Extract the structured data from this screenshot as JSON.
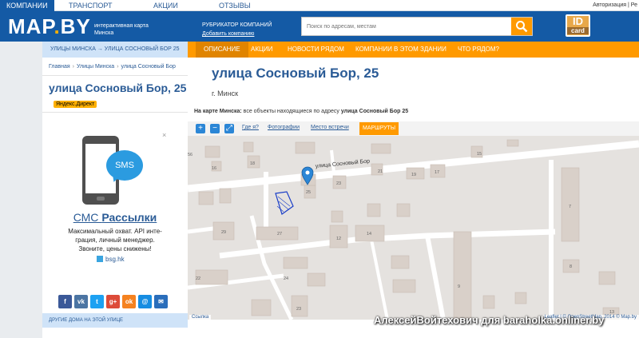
{
  "topnav": {
    "tabs": [
      {
        "label": "КОМПАНИИ"
      },
      {
        "label": "ТРАНСПОРТ"
      },
      {
        "label": "АКЦИИ"
      },
      {
        "label": "ОТЗЫВЫ"
      }
    ],
    "auth": "Авторизация | Ре"
  },
  "header": {
    "logo_main": "MAP",
    "logo_dot": ".",
    "logo_suffix": "BY",
    "tagline_1": "интерактивная карта",
    "tagline_2": "Минска",
    "rubricator": "РУБРИКАТОР КОМПАНИЙ",
    "add_company": "Добавить компанию",
    "search_placeholder": "Поиск по адресам, местам",
    "id_top": "ID",
    "id_bottom": "card"
  },
  "crumbbar": "УЛИЦЫ МИНСКА → УЛИЦА СОСНОВЫЙ БОР 25",
  "subnav": [
    {
      "label": "ОПИСАНИЕ"
    },
    {
      "label": "АКЦИИ"
    },
    {
      "label": "НОВОСТИ РЯДОМ"
    },
    {
      "label": "КОМПАНИИ В ЭТОМ ЗДАНИИ"
    },
    {
      "label": "ЧТО РЯДОМ?"
    }
  ],
  "sidebar": {
    "breadcrumbs": [
      "Главная",
      "Улицы Минска",
      "улица Сосновый Бор"
    ],
    "street_name": "улица Сосновый Бор, 25",
    "direct_badge": "Яндекс.Директ",
    "ad_close": "×",
    "ad_bubble": "SMS",
    "ad_title_1": "СМС ",
    "ad_title_2": "Рассылки",
    "ad_text_1": "Максимальный охват. API инте-",
    "ad_text_2": "грация, личный менеджер.",
    "ad_text_3": "Звоните, цены снижены!",
    "ad_link": "bsg.hk",
    "socials": [
      {
        "label": "f",
        "color": "#3b5998"
      },
      {
        "label": "vk",
        "color": "#4c75a3"
      },
      {
        "label": "t",
        "color": "#1da1f2"
      },
      {
        "label": "g+",
        "color": "#dd4b39"
      },
      {
        "label": "ok",
        "color": "#f58220"
      },
      {
        "label": "@",
        "color": "#168de2"
      },
      {
        "label": "✉",
        "color": "#2a6ebb"
      }
    ],
    "other_houses": "ДРУГИЕ ДОМА НА ЭТОЙ УЛИЦЕ"
  },
  "main": {
    "title": "улица Сосновый Бор, 25",
    "city": "г. Минск",
    "map_note_prefix": "На карте Минска:",
    "map_note_text": " все объекты находящиеся по адресу ",
    "map_note_address": "улица Сосновый Бор 25",
    "tools": [
      {
        "label": "+"
      },
      {
        "label": "−"
      },
      {
        "label": "⤢"
      }
    ],
    "links": [
      {
        "label": "Где я?"
      },
      {
        "label": "Фотографии"
      },
      {
        "label": "Место встречи"
      },
      {
        "label": "МАРШРУТЫ"
      }
    ],
    "road_label": "улица Сосновый Бор",
    "buildings": [
      "56",
      "16",
      "18",
      "15",
      "21",
      "19",
      "17",
      "23",
      "25",
      "7",
      "29",
      "27",
      "12",
      "14",
      "24",
      "9",
      "22",
      "23",
      "8",
      "13"
    ],
    "map_link": "Ссылка",
    "attribution": "Leaflet | © OpenStreetMap, 2014 © Map.by"
  },
  "watermark": "АлексейВойтехович для baraholka.onliner.by",
  "colors": {
    "brand_blue": "#145aa5",
    "accent_orange": "#ff9a00",
    "light_blue": "#cfe3f8",
    "building": "#d9d0c9",
    "road": "#ffffff",
    "marker": "#2b86d6"
  }
}
